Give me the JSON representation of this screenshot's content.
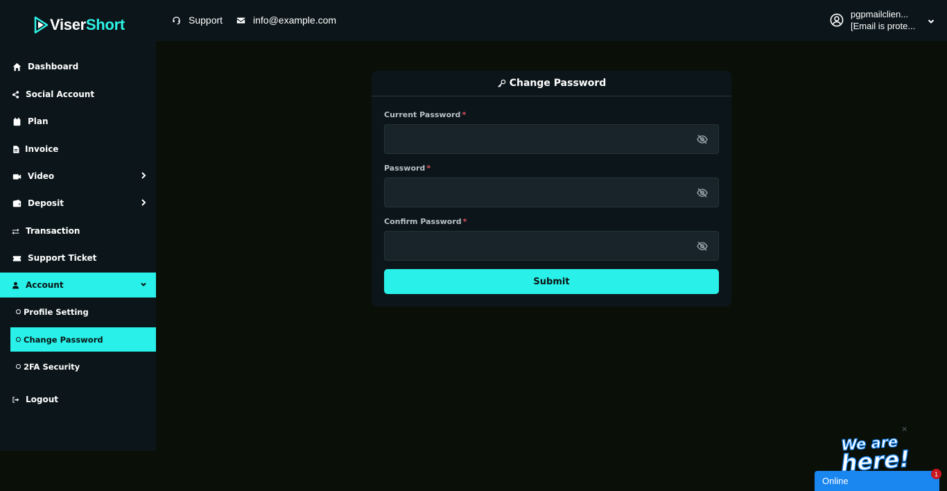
{
  "brand": {
    "part1": "Viser",
    "part2": "Short"
  },
  "header": {
    "support_label": "Support",
    "email_label": "info@example.com",
    "user_line1": "pgpmailclien...",
    "user_line2": "[Email is prote..."
  },
  "sidebar": {
    "items": [
      {
        "label": "Dashboard",
        "icon": "home-icon"
      },
      {
        "label": "Social Account",
        "icon": "share-icon"
      },
      {
        "label": "Plan",
        "icon": "calendar-icon"
      },
      {
        "label": "Invoice",
        "icon": "file-icon"
      },
      {
        "label": "Video",
        "icon": "video-icon"
      },
      {
        "label": "Deposit",
        "icon": "wallet-icon"
      },
      {
        "label": "Transaction",
        "icon": "exchange-icon"
      },
      {
        "label": "Support Ticket",
        "icon": "ticket-icon"
      },
      {
        "label": "Account",
        "icon": "user-icon"
      },
      {
        "label": "Logout",
        "icon": "logout-icon"
      }
    ],
    "account_sub": [
      {
        "label": "Profile Setting"
      },
      {
        "label": "Change Password"
      },
      {
        "label": "2FA Security"
      }
    ]
  },
  "form": {
    "title": "Change Password",
    "current_label": "Current Password",
    "password_label": "Password",
    "confirm_label": "Confirm Password",
    "required_mark": "*",
    "current_value": "",
    "password_value": "",
    "confirm_value": "",
    "submit_label": "Submit"
  },
  "chat": {
    "banner": "We are here!",
    "status": "Online",
    "badge": "1",
    "close": "×"
  },
  "colors": {
    "accent": "#29f0e8",
    "panel": "#0c161a",
    "background": "#0a0f08",
    "chat": "#1a86f0"
  }
}
